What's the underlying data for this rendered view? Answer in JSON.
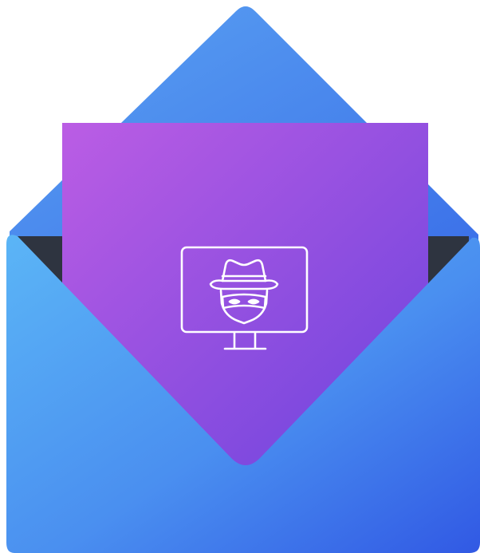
{
  "illustration": {
    "subject": "envelope-with-incognito-monitor-letter",
    "icons": {
      "envelope": "envelope-icon",
      "letter": "letter-card",
      "monitor": "monitor-icon",
      "spy": "spy-incognito-icon"
    },
    "colors": {
      "envelope_light": "#5bb5f6",
      "envelope_mid": "#4a8ff0",
      "envelope_dark": "#3159e4",
      "letter_light": "#bb5de4",
      "letter_dark": "#6b43dd",
      "envelope_interior": "#2e3440",
      "icon_stroke": "#ffffff",
      "background": "#ffffff"
    }
  }
}
